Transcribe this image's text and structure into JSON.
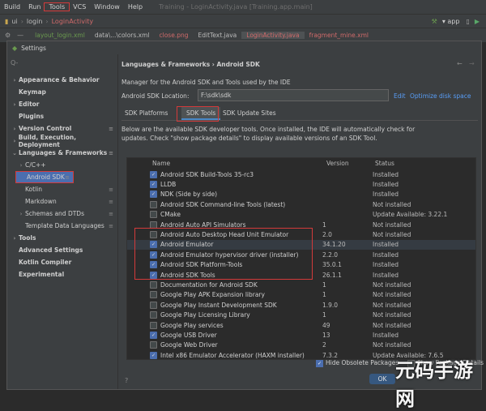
{
  "menubar": {
    "items": [
      "Build",
      "Run",
      "Tools",
      "VCS",
      "Window",
      "Help"
    ],
    "title": "Training - LoginActivity.java [Training.app.main]"
  },
  "navbar": {
    "crumbs": [
      "ui",
      "login",
      "LoginActivity"
    ],
    "run_config": "app"
  },
  "tabs": [
    "layout_login.xml",
    "data\\...\\colors.xml",
    "close.png",
    "EditText.java",
    "LoginActivity.java",
    "fragment_mine.xml"
  ],
  "dialog": {
    "title": "Settings",
    "search_placeholder": "Q-"
  },
  "sidebar": {
    "items": [
      {
        "label": "Appearance & Behavior",
        "chevron": "›",
        "bold": true
      },
      {
        "label": "Keymap",
        "chevron": "",
        "bold": true
      },
      {
        "label": "Editor",
        "chevron": "›",
        "bold": true
      },
      {
        "label": "Plugins",
        "chevron": "",
        "bold": true
      },
      {
        "label": "Version Control",
        "chevron": "›",
        "bold": true
      },
      {
        "label": "Build, Execution, Deployment",
        "chevron": "›",
        "bold": true
      },
      {
        "label": "Languages & Frameworks",
        "chevron": "⌄",
        "bold": true
      },
      {
        "label": "C/C++",
        "chevron": "›",
        "bold": false
      },
      {
        "label": "Android SDK",
        "chevron": "",
        "bold": false
      },
      {
        "label": "Kotlin",
        "chevron": "",
        "bold": false
      },
      {
        "label": "Markdown",
        "chevron": "",
        "bold": false
      },
      {
        "label": "Schemas and DTDs",
        "chevron": "›",
        "bold": false
      },
      {
        "label": "Template Data Languages",
        "chevron": "",
        "bold": false
      },
      {
        "label": "Tools",
        "chevron": "›",
        "bold": true
      },
      {
        "label": "Advanced Settings",
        "chevron": "",
        "bold": true
      },
      {
        "label": "Kotlin Compiler",
        "chevron": "",
        "bold": true
      },
      {
        "label": "Experimental",
        "chevron": "",
        "bold": true
      }
    ]
  },
  "content": {
    "breadcrumb": "Languages & Frameworks  ›  Android SDK",
    "description": "Manager for the Android SDK and Tools used by the IDE",
    "location_label": "Android SDK Location:",
    "location_value": "F:\\sdk\\sdk",
    "edit_link": "Edit",
    "optimize_link": "Optimize disk space",
    "subtabs": [
      "SDK Platforms",
      "SDK Tools",
      "SDK Update Sites"
    ],
    "info_line1": "Below are the available SDK developer tools. Once installed, the IDE will automatically check for",
    "info_line2": "updates. Check \"show package details\" to display available versions of an SDK Tool.",
    "columns": {
      "name": "Name",
      "version": "Version",
      "status": "Status"
    },
    "rows": [
      {
        "name": "Android SDK Build-Tools 35-rc3",
        "version": "",
        "status": "Installed",
        "checked": true
      },
      {
        "name": "LLDB",
        "version": "",
        "status": "Installed",
        "checked": true
      },
      {
        "name": "NDK (Side by side)",
        "version": "",
        "status": "Installed",
        "checked": true
      },
      {
        "name": "Android SDK Command-line Tools (latest)",
        "version": "",
        "status": "Not installed",
        "checked": false
      },
      {
        "name": "CMake",
        "version": "",
        "status": "Update Available: 3.22.1",
        "checked": false
      },
      {
        "name": "Android Auto API Simulators",
        "version": "1",
        "status": "Not installed",
        "checked": false
      },
      {
        "name": "Android Auto Desktop Head Unit Emulator",
        "version": "2.0",
        "status": "Not installed",
        "checked": false
      },
      {
        "name": "Android Emulator",
        "version": "34.1.20",
        "status": "Installed",
        "checked": true
      },
      {
        "name": "Android Emulator hypervisor driver (installer)",
        "version": "2.2.0",
        "status": "Installed",
        "checked": true
      },
      {
        "name": "Android SDK Platform-Tools",
        "version": "35.0.1",
        "status": "Installed",
        "checked": true
      },
      {
        "name": "Android SDK Tools",
        "version": "26.1.1",
        "status": "Installed",
        "checked": true
      },
      {
        "name": "Documentation for Android SDK",
        "version": "1",
        "status": "Not installed",
        "checked": false
      },
      {
        "name": "Google Play APK Expansion library",
        "version": "1",
        "status": "Not installed",
        "checked": false
      },
      {
        "name": "Google Play Instant Development SDK",
        "version": "1.9.0",
        "status": "Not installed",
        "checked": false
      },
      {
        "name": "Google Play Licensing Library",
        "version": "1",
        "status": "Not installed",
        "checked": false
      },
      {
        "name": "Google Play services",
        "version": "49",
        "status": "Not installed",
        "checked": false
      },
      {
        "name": "Google USB Driver",
        "version": "13",
        "status": "Installed",
        "checked": true
      },
      {
        "name": "Google Web Driver",
        "version": "2",
        "status": "Not installed",
        "checked": false
      },
      {
        "name": "Intel x86 Emulator Accelerator (HAXM installer)",
        "version": "7.3.2",
        "status": "Update Available: 7.6.5",
        "checked": true
      }
    ],
    "hide_obsolete": "Hide Obsolete Packages",
    "show_details": "Show Package Details",
    "ok": "OK"
  },
  "watermark": "元码手游网"
}
